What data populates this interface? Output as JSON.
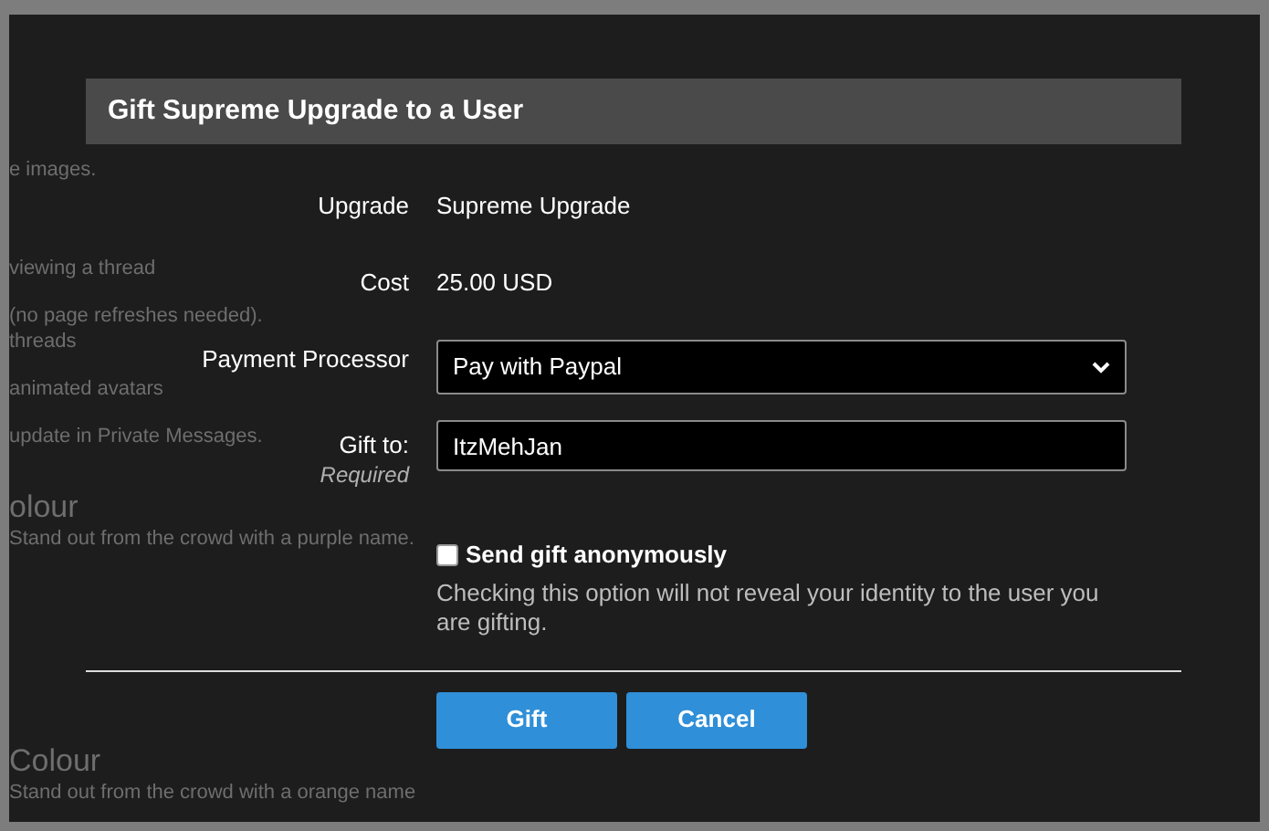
{
  "background_page": {
    "fragments": [
      {
        "text": "e images.",
        "kind": "line"
      },
      {
        "text": "viewing a thread",
        "kind": "line"
      },
      {
        "text": "(no page refreshes needed).",
        "kind": "line"
      },
      {
        "text": "threads",
        "kind": "line"
      },
      {
        "text": "animated avatars",
        "kind": "line"
      },
      {
        "text": "update in Private Messages.",
        "kind": "line"
      },
      {
        "text": "olour",
        "kind": "heading"
      },
      {
        "text": "Stand out from the crowd with a purple name.",
        "kind": "line"
      },
      {
        "text": "Colour",
        "kind": "heading"
      },
      {
        "text": "Stand out from the crowd with a orange name",
        "kind": "line"
      }
    ]
  },
  "dialog": {
    "title": "Gift Supreme Upgrade to a User",
    "fields": [
      {
        "label": "Upgrade",
        "kind": "text",
        "value": "Supreme Upgrade"
      },
      {
        "label": "Cost",
        "kind": "text",
        "value": "25.00 USD"
      },
      {
        "label": "Payment Processor",
        "kind": "select",
        "value": "Pay with Paypal"
      },
      {
        "label": "Gift to:",
        "hint": "Required",
        "kind": "input",
        "value": "ItzMehJan"
      }
    ],
    "anonymous": {
      "label": "Send gift anonymously",
      "checked": false,
      "explain": "Checking this option will not reveal your identity to the user you are gifting."
    },
    "buttons": [
      "Gift",
      "Cancel"
    ]
  }
}
